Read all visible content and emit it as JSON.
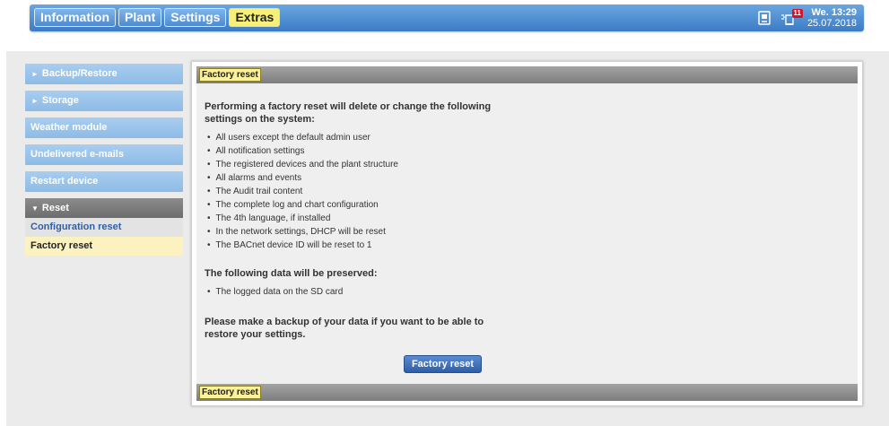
{
  "header": {
    "tabs": [
      {
        "label": "Information"
      },
      {
        "label": "Plant"
      },
      {
        "label": "Settings"
      },
      {
        "label": "Extras"
      }
    ],
    "notification_count": "11",
    "day_time": "We. 13:29",
    "date": "25.07.2018"
  },
  "sidebar": {
    "items": [
      {
        "label": "Backup/Restore",
        "arrow": "►"
      },
      {
        "label": "Storage",
        "arrow": "►"
      },
      {
        "label": "Weather module"
      },
      {
        "label": "Undelivered e-mails"
      },
      {
        "label": "Restart device"
      }
    ],
    "group": {
      "label": "Reset",
      "arrow": "▼",
      "subitems": [
        {
          "label": "Configuration reset"
        },
        {
          "label": "Factory reset"
        }
      ]
    }
  },
  "panel": {
    "header_label": "Factory reset",
    "footer_label": "Factory reset",
    "intro": "Performing a factory reset will delete or change the following settings on the system:",
    "delete_items": [
      "All users except the default admin user",
      "All notification settings",
      "The registered devices and the plant structure",
      "All alarms and events",
      "The Audit trail content",
      "The complete log and chart configuration",
      "The 4th language, if installed",
      "In the network settings, DHCP will be reset",
      "The BACnet device ID will be reset to 1"
    ],
    "preserved_heading": "The following data will be preserved:",
    "preserved_items": [
      "The logged data on the SD card"
    ],
    "backup_note": "Please make a backup of your data if you want to be able to restore your settings.",
    "button_label": "Factory reset"
  },
  "colors": {
    "header_blue": "#3c7cc6",
    "active_tab": "#f7ef78",
    "button_blue": "#2f5ea8"
  }
}
